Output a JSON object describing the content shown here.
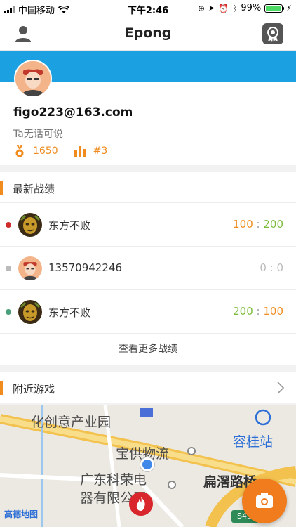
{
  "status_bar": {
    "carrier": "中国移动",
    "time": "下午2:46",
    "battery": "99%",
    "battery_level": 0.99
  },
  "nav": {
    "title": "Epong",
    "left_icon": "user-icon",
    "right_icon": "award-icon"
  },
  "profile": {
    "email": "figo223@163.com",
    "bio": "Ta无话可说",
    "points": "1650",
    "rank": "#3",
    "colors": {
      "accent": "#f08c1e",
      "banner": "#1ba1e2"
    }
  },
  "records": {
    "title": "最新战绩",
    "items": [
      {
        "name": "东方不败",
        "score": "100 : 200",
        "dot": "#d02a2a",
        "avatar": "mask"
      },
      {
        "name": "13570942246",
        "score": "0 : 0",
        "dot": "#bbbbbb",
        "avatar": "cartoon"
      },
      {
        "name": "东方不败",
        "score": "200 : 100",
        "dot": "#4aa07a",
        "avatar": "mask"
      }
    ],
    "more": "查看更多战绩"
  },
  "nearby": {
    "title": "附近游戏"
  },
  "map": {
    "labels": [
      {
        "text": "化创意产业园"
      },
      {
        "text": "宝供物流"
      },
      {
        "text": "容桂站"
      },
      {
        "text": "广东科荣电"
      },
      {
        "text": "器有限公司"
      },
      {
        "text": "扁滘路桥"
      }
    ],
    "logo": "高德地图",
    "road_number": "S43"
  }
}
